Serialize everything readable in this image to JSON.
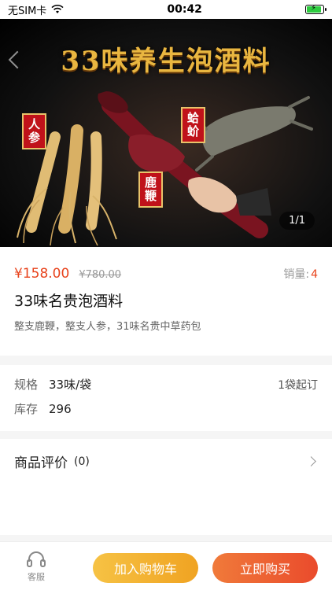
{
  "status_bar": {
    "carrier": "无SIM卡",
    "time": "00:42"
  },
  "hero": {
    "banner_title": "33味养生泡酒料",
    "tags": [
      "人参",
      "鹿鞭",
      "蛤蚧"
    ],
    "page_indicator": "1/1"
  },
  "product": {
    "price": "¥158.00",
    "original_price": "¥780.00",
    "sales_label": "销量:",
    "sales_count": "4",
    "title": "33味名贵泡酒料",
    "subtitle": "整支鹿鞭，整支人参，31味名贵中草药包"
  },
  "specs": {
    "spec_label": "规格",
    "spec_value": "33味/袋",
    "min_order": "1袋起订",
    "stock_label": "库存",
    "stock_value": "296"
  },
  "reviews": {
    "label": "商品评价",
    "count": "(0)"
  },
  "bottom_bar": {
    "service_label": "客服",
    "add_to_cart": "加入购物车",
    "buy_now": "立即购买"
  },
  "colors": {
    "price_red": "#e8431c",
    "cart_button": "#f0a322",
    "buy_button": "#ea4b2c",
    "banner_gold": "#e9b640",
    "tag_red": "#c0121a"
  }
}
